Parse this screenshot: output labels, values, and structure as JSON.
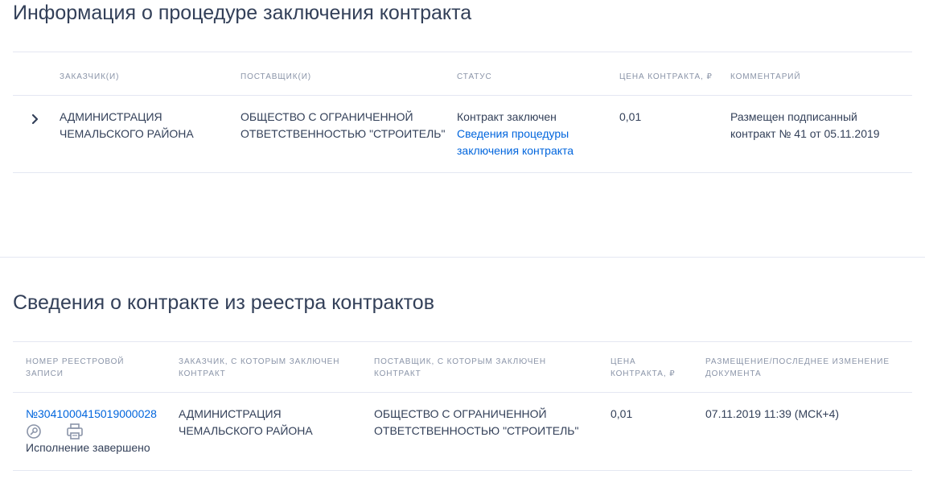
{
  "section1": {
    "title": "Информация о процедуре заключения контракта",
    "columns": {
      "customer": "ЗАКАЗЧИК(И)",
      "supplier": "ПОСТАВЩИК(И)",
      "status": "СТАТУС",
      "price": "ЦЕНА КОНТРАКТА, ₽",
      "comment": "КОММЕНТАРИЙ"
    },
    "row": {
      "customer": [
        "АДМИНИСТРАЦИЯ",
        "ЧЕМАЛЬСКОГО РАЙОНА"
      ],
      "supplier": [
        "ОБЩЕСТВО С ОГРАНИЧЕННОЙ",
        "ОТВЕТСТВЕННОСТЬЮ \"СТРОИТЕЛЬ\""
      ],
      "status": "Контракт заключен",
      "status_link": [
        "Сведения процедуры",
        "заключения контракта"
      ],
      "price": "0,01",
      "comment": [
        "Размещен подписанный",
        "контракт № 41 от 05.11.2019"
      ]
    },
    "expand_icon": "chevron-right-icon"
  },
  "section2": {
    "title": "Сведения о контракте из реестра контрактов",
    "columns": {
      "registry": [
        "НОМЕР РЕЕСТРОВОЙ",
        "ЗАПИСИ"
      ],
      "customer": [
        "ЗАКАЗЧИК, С КОТОРЫМ ЗАКЛЮЧЕН",
        "КОНТРАКТ"
      ],
      "supplier": [
        "ПОСТАВЩИК, С КОТОРЫМ ЗАКЛЮЧЕН",
        "КОНТРАКТ"
      ],
      "price": [
        "ЦЕНА",
        "КОНТРАКТА, ₽"
      ],
      "posted": [
        "РАЗМЕЩЕНИЕ/ПОСЛЕДНЕЕ ИЗМЕНЕНИЕ",
        "ДОКУМЕНТА"
      ]
    },
    "row": {
      "registry_number": "№3041000415019000028",
      "execution_status": "Исполнение завершено",
      "customer": [
        "АДМИНИСТРАЦИЯ",
        "ЧЕМАЛЬСКОГО РАЙОНА"
      ],
      "supplier": [
        "ОБЩЕСТВО С ОГРАНИЧЕННОЙ",
        "ОТВЕТСТВЕННОСТЬЮ \"СТРОИТЕЛЬ\""
      ],
      "price": "0,01",
      "posted": "07.11.2019 11:39 (МСК+4)"
    },
    "icons": [
      "view-icon",
      "print-icon"
    ]
  },
  "colors": {
    "link": "#0065dd",
    "text": "#334059",
    "header": "#8a94a8",
    "divider": "#e4e7f2"
  }
}
